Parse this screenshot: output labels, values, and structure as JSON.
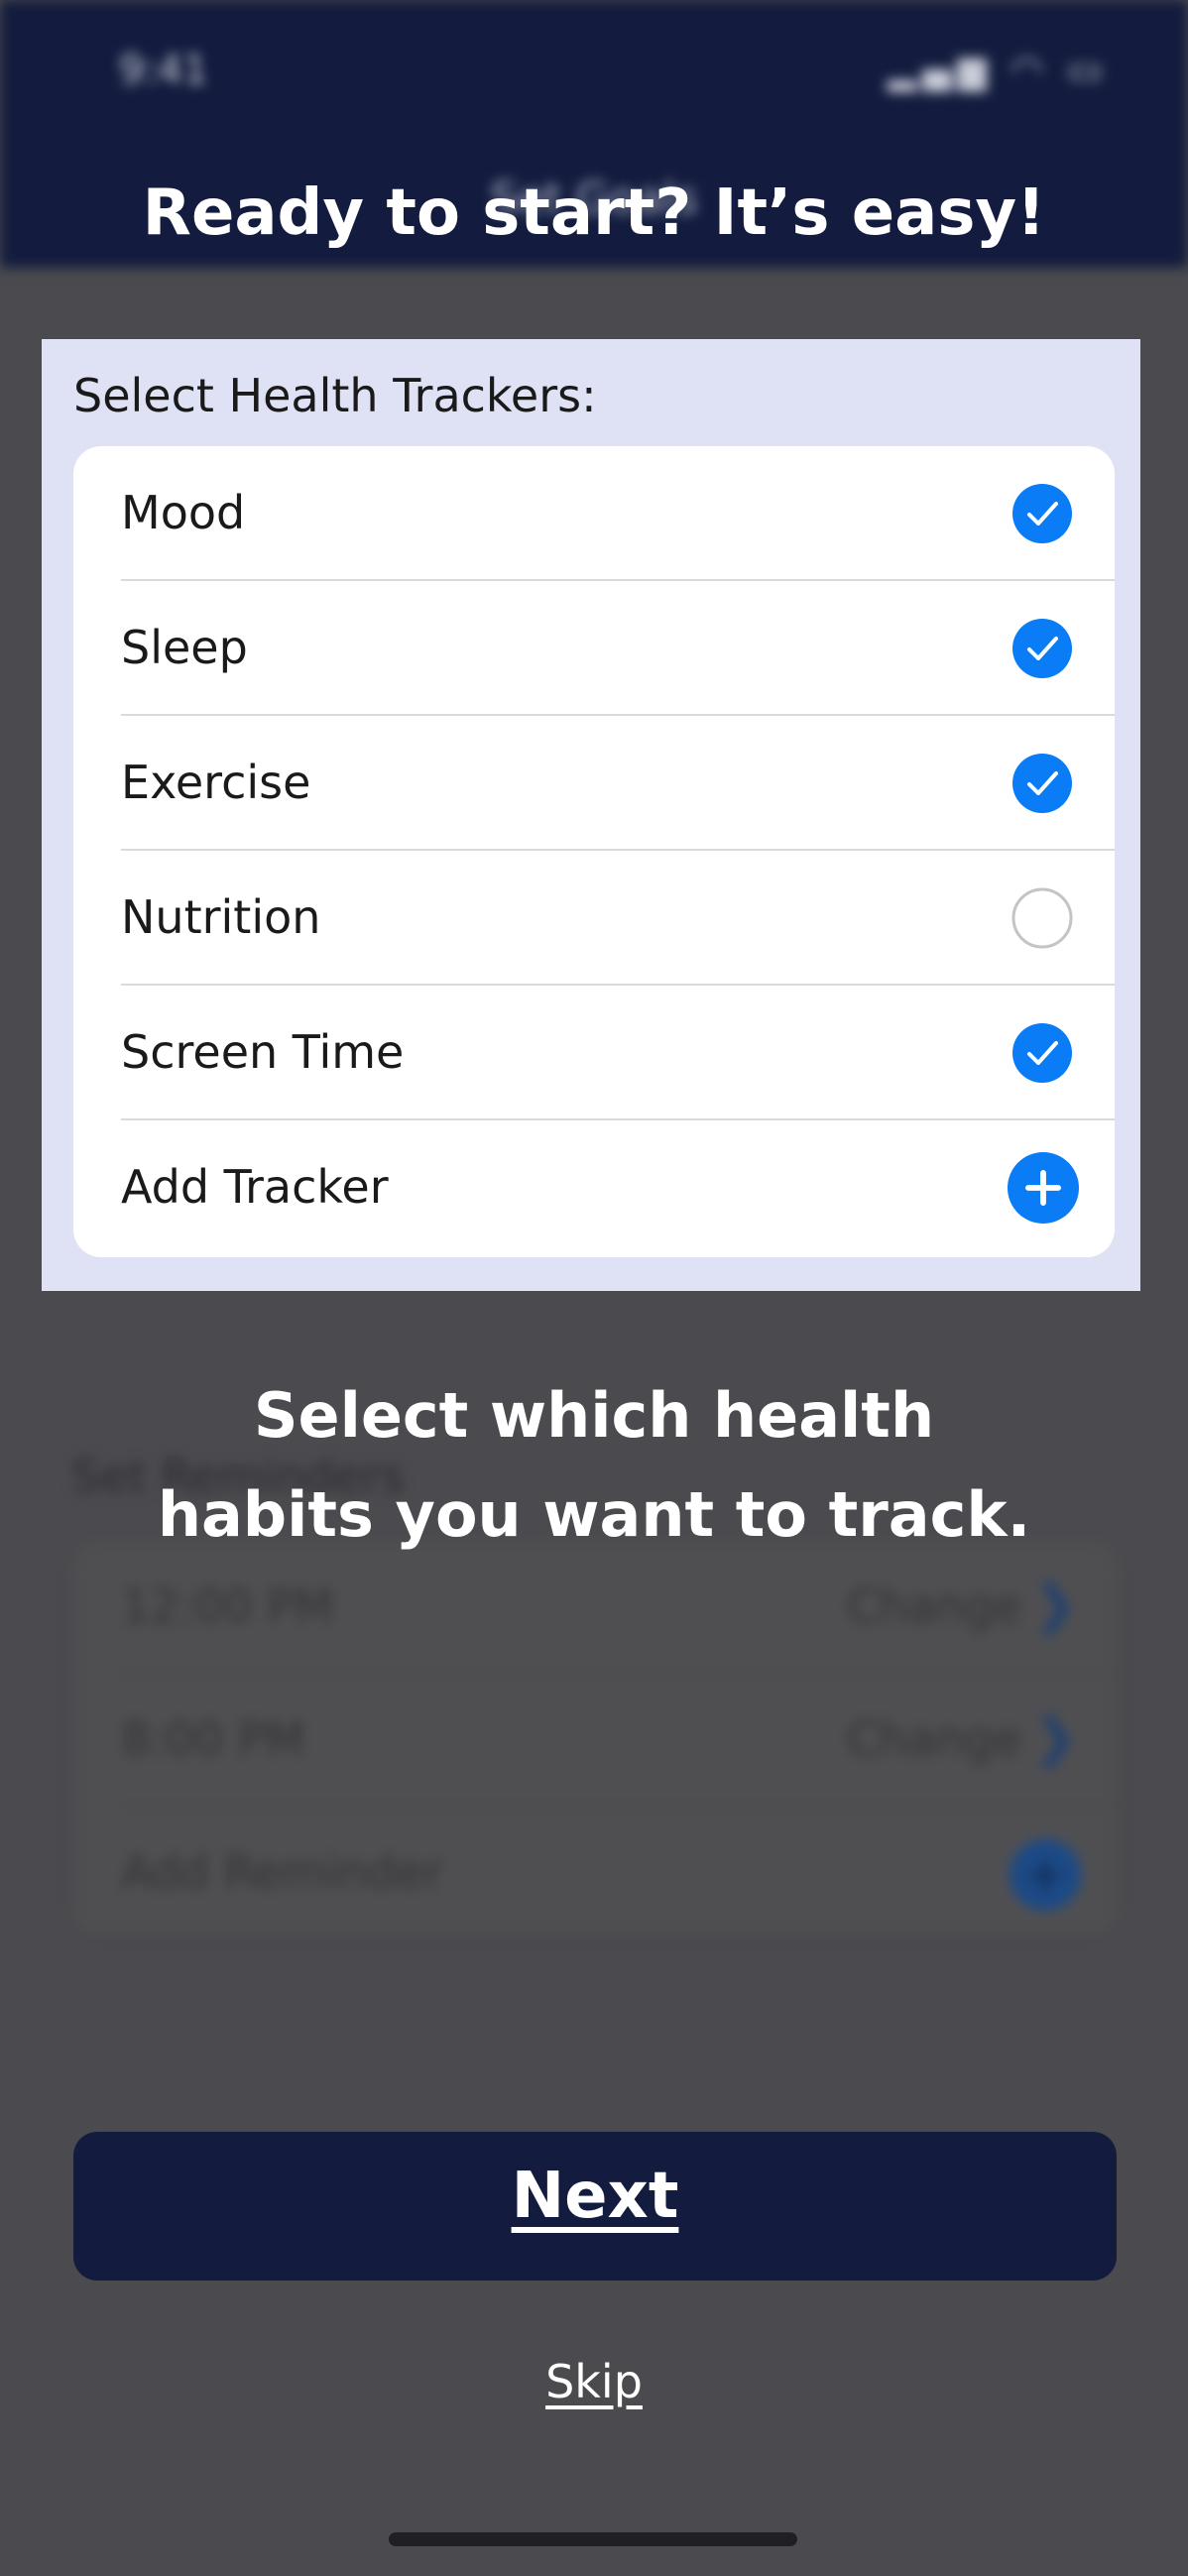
{
  "status_bar": {
    "time": "9:41",
    "icons": "▂▄▆ ◠ ▭"
  },
  "background": {
    "header_title": "Set Goals",
    "reminders": {
      "label": "Set Reminders",
      "items": [
        {
          "time": "12:00 PM",
          "action": "Change"
        },
        {
          "time": "8:00 PM",
          "action": "Change"
        }
      ],
      "add_label": "Add Reminder"
    }
  },
  "coach": {
    "title": "Ready to start? It’s easy!",
    "trackers_label": "Select Health Trackers:",
    "trackers": [
      {
        "label": "Mood",
        "checked": true
      },
      {
        "label": "Sleep",
        "checked": true
      },
      {
        "label": "Exercise",
        "checked": true
      },
      {
        "label": "Nutrition",
        "checked": false
      },
      {
        "label": "Screen Time",
        "checked": true
      },
      {
        "label": "Add Tracker",
        "add": true
      }
    ],
    "caption_line1": "Select which health",
    "caption_line2": "habits you want to track."
  },
  "actions": {
    "next_label": "Next",
    "skip_label": "Skip"
  },
  "colors": {
    "accent": "#0a7cf5",
    "navy": "#131c3e",
    "panel": "#dfe1f5"
  },
  "icons": {
    "check": "checkmark-circle-icon",
    "empty": "empty-circle-icon",
    "add": "plus-circle-icon",
    "chevron": "chevron-right-icon"
  }
}
